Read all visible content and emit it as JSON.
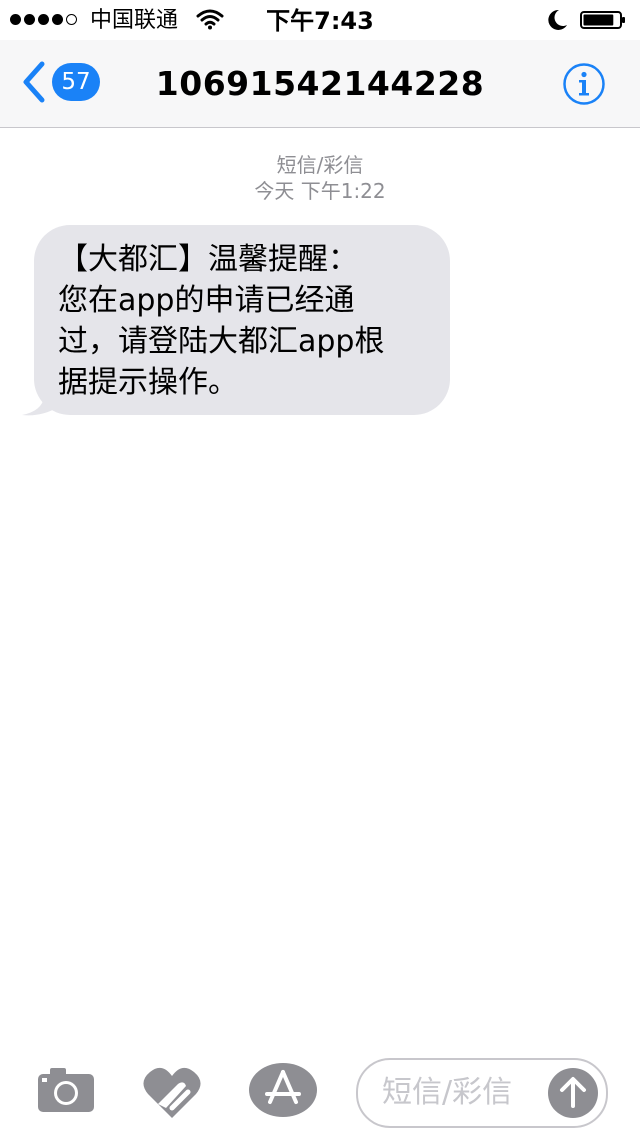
{
  "status_bar": {
    "carrier": "中国联通",
    "time": "下午7:43",
    "signal_filled": 4,
    "signal_total": 5,
    "battery_level": 0.85
  },
  "nav": {
    "back_count": "57",
    "title": "10691542144228",
    "info_icon": "info-circle-icon",
    "accent_color": "#1a82f7"
  },
  "conversation": {
    "service_label": "短信/彩信",
    "timestamp": "今天 下午1:22",
    "messages": [
      {
        "direction": "incoming",
        "text": "【大都汇】温馨提醒：\n您在app的申请已经通\n过，请登陆大都汇app根\n据提示操作。"
      }
    ]
  },
  "input_bar": {
    "placeholder": "短信/彩信",
    "icons": [
      "camera-icon",
      "digital-touch-icon",
      "app-store-icon",
      "send-arrow-icon"
    ]
  }
}
